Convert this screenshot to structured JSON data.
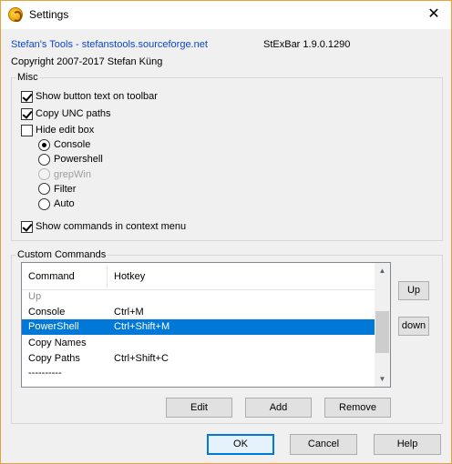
{
  "window": {
    "title": "Settings",
    "close_glyph": "✕"
  },
  "header": {
    "tools_link": "Stefan's Tools - stefanstools.sourceforge.net",
    "version": "StExBar 1.9.0.1290",
    "copyright": "Copyright 2007-2017 Stefan Küng"
  },
  "misc": {
    "legend": "Misc",
    "show_button_text": {
      "label": "Show button text on toolbar",
      "checked": true
    },
    "copy_unc": {
      "label": "Copy UNC paths",
      "checked": true
    },
    "hide_edit_box": {
      "label": "Hide edit box",
      "checked": false
    },
    "radios": [
      {
        "label": "Console",
        "selected": true,
        "enabled": true
      },
      {
        "label": "Powershell",
        "selected": false,
        "enabled": true
      },
      {
        "label": "grepWin",
        "selected": false,
        "enabled": false
      },
      {
        "label": "Filter",
        "selected": false,
        "enabled": true
      },
      {
        "label": "Auto",
        "selected": false,
        "enabled": true
      }
    ],
    "show_commands_context": {
      "label": "Show commands in context menu",
      "checked": true
    }
  },
  "custom_commands": {
    "legend": "Custom Commands",
    "columns": [
      "Command",
      "Hotkey"
    ],
    "rows": [
      {
        "command": "Up",
        "hotkey": "",
        "state": "faded"
      },
      {
        "command": "Console",
        "hotkey": "Ctrl+M",
        "state": ""
      },
      {
        "command": "PowerShell",
        "hotkey": "Ctrl+Shift+M",
        "state": "selected"
      },
      {
        "command": "Copy Names",
        "hotkey": "",
        "state": ""
      },
      {
        "command": "Copy Paths",
        "hotkey": "Ctrl+Shift+C",
        "state": ""
      },
      {
        "command": "----------",
        "hotkey": "",
        "state": ""
      }
    ],
    "up_button": "Up",
    "down_button": "down",
    "edit_button": "Edit",
    "add_button": "Add",
    "remove_button": "Remove"
  },
  "footer": {
    "ok": "OK",
    "cancel": "Cancel",
    "help": "Help"
  },
  "icons": {
    "scroll_up": "▲",
    "scroll_down": "▼"
  },
  "colors": {
    "accent": "#0078d7",
    "link": "#0b46c9"
  }
}
